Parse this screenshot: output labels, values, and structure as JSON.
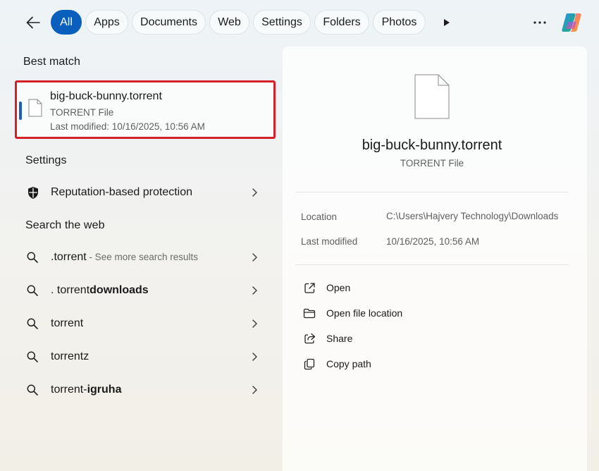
{
  "tabs": [
    {
      "label": "All",
      "active": true
    },
    {
      "label": "Apps"
    },
    {
      "label": "Documents"
    },
    {
      "label": "Web"
    },
    {
      "label": "Settings"
    },
    {
      "label": "Folders"
    },
    {
      "label": "Photos"
    }
  ],
  "best_match": {
    "title": "Best match",
    "name": "big-buck-bunny.torrent",
    "type": "TORRENT File",
    "modified": "Last modified: 10/16/2025, 10:56 AM"
  },
  "settings_section": {
    "title": "Settings",
    "items": [
      {
        "label": "Reputation-based protection"
      }
    ]
  },
  "web_section": {
    "title": "Search the web",
    "items": [
      {
        "normal": ".torrent",
        "bold": "",
        "hint": " - See more search results"
      },
      {
        "normal": ". torrent",
        "bold": "downloads",
        "hint": ""
      },
      {
        "normal": "torrent",
        "bold": "",
        "hint": ""
      },
      {
        "normal": "torrentz",
        "bold": "",
        "hint": ""
      },
      {
        "normal": "torrent-",
        "bold": "igruha",
        "hint": ""
      }
    ]
  },
  "preview": {
    "name": "big-buck-bunny.torrent",
    "type": "TORRENT File",
    "properties": [
      {
        "label": "Location",
        "value": "C:\\Users\\Hajvery Technology\\Downloads"
      },
      {
        "label": "Last modified",
        "value": "10/16/2025, 10:56 AM"
      }
    ],
    "actions": [
      {
        "label": "Open",
        "icon": "open-external-icon"
      },
      {
        "label": "Open file location",
        "icon": "folder-icon"
      },
      {
        "label": "Share",
        "icon": "share-icon"
      },
      {
        "label": "Copy path",
        "icon": "copy-icon"
      }
    ]
  },
  "colors": {
    "accent": "#0a5fbd",
    "highlight_border": "#d3202a"
  }
}
